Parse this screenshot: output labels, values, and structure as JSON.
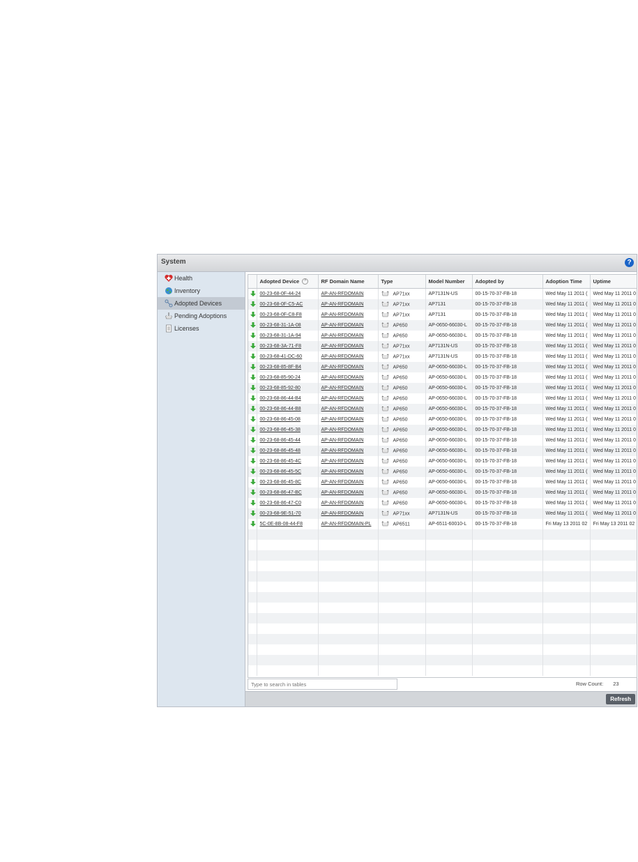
{
  "window": {
    "title": "System",
    "help_icon": "?"
  },
  "sidebar": {
    "items": [
      {
        "label": "Health",
        "icon": "health-icon"
      },
      {
        "label": "Inventory",
        "icon": "globe-icon"
      },
      {
        "label": "Adopted Devices",
        "icon": "adopted-devices-icon",
        "active": true
      },
      {
        "label": "Pending Adoptions",
        "icon": "access-point-icon"
      },
      {
        "label": "Licenses",
        "icon": "document-icon"
      }
    ]
  },
  "table": {
    "columns": [
      "Adopted Device",
      "RF Domain Name",
      "Type",
      "Model Number",
      "Adopted by",
      "Adoption Time",
      "Uptime"
    ],
    "rows": [
      [
        "00-23-68-0F-44-24",
        "AP-AN-RFDOMAIN",
        "AP71xx",
        "AP7131N-US",
        "00-15-70-37-FB-18",
        "Wed May 11 2011 (",
        "Wed May 11 2011 0"
      ],
      [
        "00-23-68-0F-C5-AC",
        "AP-AN-RFDOMAIN",
        "AP71xx",
        "AP7131",
        "00-15-70-37-FB-18",
        "Wed May 11 2011 (",
        "Wed May 11 2011 0"
      ],
      [
        "00-23-68-0F-C8-F8",
        "AP-AN-RFDOMAIN",
        "AP71xx",
        "AP7131",
        "00-15-70-37-FB-18",
        "Wed May 11 2011 (",
        "Wed May 11 2011 0"
      ],
      [
        "00-23-68-31-1A-08",
        "AP-AN-RFDOMAIN",
        "AP650",
        "AP-0650-66030-L",
        "00-15-70-37-FB-18",
        "Wed May 11 2011 (",
        "Wed May 11 2011 0"
      ],
      [
        "00-23-68-31-1A-94",
        "AP-AN-RFDOMAIN",
        "AP650",
        "AP-0650-66030-L",
        "00-15-70-37-FB-18",
        "Wed May 11 2011 (",
        "Wed May 11 2011 0"
      ],
      [
        "00-23-68-3A-71-F8",
        "AP-AN-RFDOMAIN",
        "AP71xx",
        "AP7131N-US",
        "00-15-70-37-FB-18",
        "Wed May 11 2011 (",
        "Wed May 11 2011 0"
      ],
      [
        "00-23-68-41-DC-60",
        "AP-AN-RFDOMAIN",
        "AP71xx",
        "AP7131N-US",
        "00-15-70-37-FB-18",
        "Wed May 11 2011 (",
        "Wed May 11 2011 0"
      ],
      [
        "00-23-68-85-8F-B4",
        "AP-AN-RFDOMAIN",
        "AP650",
        "AP-0650-66030-L",
        "00-15-70-37-FB-18",
        "Wed May 11 2011 (",
        "Wed May 11 2011 0"
      ],
      [
        "00-23-68-85-90-24",
        "AP-AN-RFDOMAIN",
        "AP650",
        "AP-0650-66030-L",
        "00-15-70-37-FB-18",
        "Wed May 11 2011 (",
        "Wed May 11 2011 0"
      ],
      [
        "00-23-68-85-92-80",
        "AP-AN-RFDOMAIN",
        "AP650",
        "AP-0650-66030-L",
        "00-15-70-37-FB-18",
        "Wed May 11 2011 (",
        "Wed May 11 2011 0"
      ],
      [
        "00-23-68-86-44-B4",
        "AP-AN-RFDOMAIN",
        "AP650",
        "AP-0650-66030-L",
        "00-15-70-37-FB-18",
        "Wed May 11 2011 (",
        "Wed May 11 2011 0"
      ],
      [
        "00-23-68-86-44-B8",
        "AP-AN-RFDOMAIN",
        "AP650",
        "AP-0650-66030-L",
        "00-15-70-37-FB-18",
        "Wed May 11 2011 (",
        "Wed May 11 2011 0"
      ],
      [
        "00-23-68-86-45-08",
        "AP-AN-RFDOMAIN",
        "AP650",
        "AP-0650-66030-L",
        "00-15-70-37-FB-18",
        "Wed May 11 2011 (",
        "Wed May 11 2011 0"
      ],
      [
        "00-23-68-86-45-38",
        "AP-AN-RFDOMAIN",
        "AP650",
        "AP-0650-66030-L",
        "00-15-70-37-FB-18",
        "Wed May 11 2011 (",
        "Wed May 11 2011 0"
      ],
      [
        "00-23-68-86-45-44",
        "AP-AN-RFDOMAIN",
        "AP650",
        "AP-0650-66030-L",
        "00-15-70-37-FB-18",
        "Wed May 11 2011 (",
        "Wed May 11 2011 0"
      ],
      [
        "00-23-68-86-45-48",
        "AP-AN-RFDOMAIN",
        "AP650",
        "AP-0650-66030-L",
        "00-15-70-37-FB-18",
        "Wed May 11 2011 (",
        "Wed May 11 2011 0"
      ],
      [
        "00-23-68-86-45-4C",
        "AP-AN-RFDOMAIN",
        "AP650",
        "AP-0650-66030-L",
        "00-15-70-37-FB-18",
        "Wed May 11 2011 (",
        "Wed May 11 2011 0"
      ],
      [
        "00-23-68-86-45-5C",
        "AP-AN-RFDOMAIN",
        "AP650",
        "AP-0650-66030-L",
        "00-15-70-37-FB-18",
        "Wed May 11 2011 (",
        "Wed May 11 2011 0"
      ],
      [
        "00-23-68-86-45-8C",
        "AP-AN-RFDOMAIN",
        "AP650",
        "AP-0650-66030-L",
        "00-15-70-37-FB-18",
        "Wed May 11 2011 (",
        "Wed May 11 2011 0"
      ],
      [
        "00-23-68-86-47-BC",
        "AP-AN-RFDOMAIN",
        "AP650",
        "AP-0650-66030-L",
        "00-15-70-37-FB-18",
        "Wed May 11 2011 (",
        "Wed May 11 2011 0"
      ],
      [
        "00-23-68-86-47-C0",
        "AP-AN-RFDOMAIN",
        "AP650",
        "AP-0650-66030-L",
        "00-15-70-37-FB-18",
        "Wed May 11 2011 (",
        "Wed May 11 2011 0"
      ],
      [
        "00-23-68-9E-51-70",
        "AP-AN-RFDOMAIN",
        "AP71xx",
        "AP7131N-US",
        "00-15-70-37-FB-18",
        "Wed May 11 2011 (",
        "Wed May 11 2011 0"
      ],
      [
        "5C-0E-8B-08-44-F8",
        "AP-AN-RFDOMAIN-PL",
        "AP6511",
        "AP-6511-60010-L",
        "00-15-70-37-FB-18",
        "Fri May 13 2011 02",
        "Fri May 13 2011 02"
      ]
    ],
    "empty_rows": 14
  },
  "search": {
    "placeholder": "Type to search in tables"
  },
  "row_count": {
    "label": "Row Count:",
    "value": "23"
  },
  "footer": {
    "refresh_label": "Refresh"
  },
  "colors": {
    "accent": "#1a64c8",
    "arrow": "#3aa93a",
    "sidebar_bg": "#dde6ef"
  }
}
